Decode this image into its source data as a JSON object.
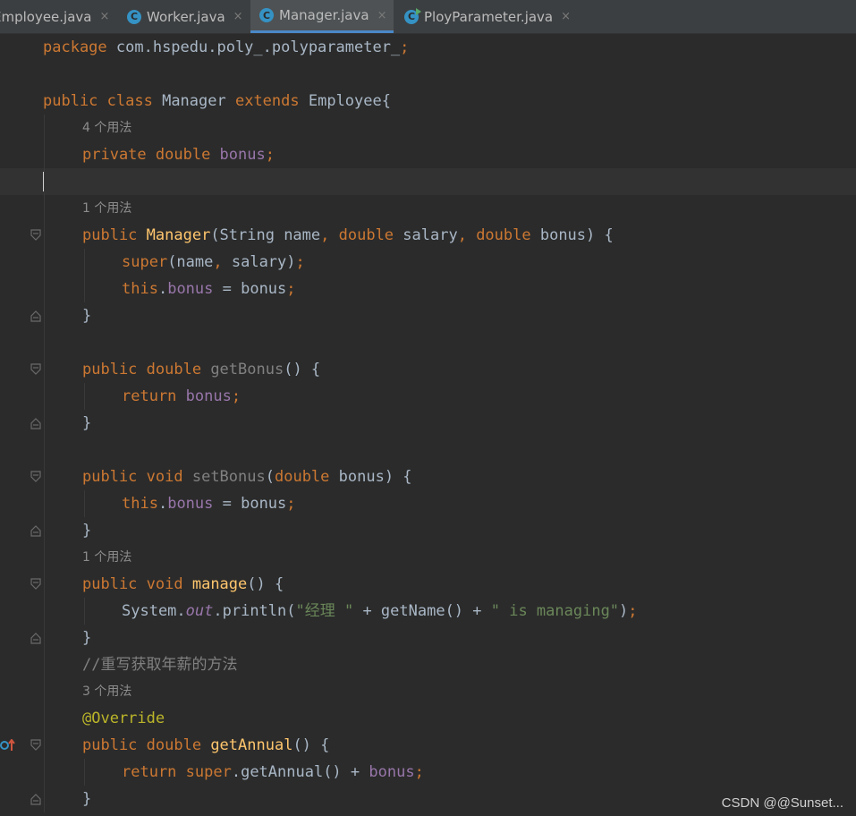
{
  "tabs": [
    {
      "label": "Employee.java",
      "icon": "class-icon",
      "active": false
    },
    {
      "label": "Worker.java",
      "icon": "class-icon",
      "active": false
    },
    {
      "label": "Manager.java",
      "icon": "class-icon",
      "active": true
    },
    {
      "label": "PloyParameter.java",
      "icon": "runnable-class-icon",
      "active": false
    }
  ],
  "tab_close_glyph": "×",
  "class_icon_letter": "C",
  "editor": {
    "lines": [
      {
        "indent": 0,
        "tokens": [
          {
            "t": "package ",
            "c": "kw"
          },
          {
            "t": "com.hspedu.poly_.polyparameter_",
            "c": "plain"
          },
          {
            "t": ";",
            "c": "kw"
          }
        ]
      },
      {
        "indent": 0,
        "tokens": []
      },
      {
        "indent": 0,
        "tokens": [
          {
            "t": "public ",
            "c": "kw"
          },
          {
            "t": "class ",
            "c": "kw"
          },
          {
            "t": "Manager ",
            "c": "plain"
          },
          {
            "t": "extends ",
            "c": "kw"
          },
          {
            "t": "Employee{",
            "c": "plain"
          }
        ]
      },
      {
        "indent": 1,
        "hint": "4 个用法"
      },
      {
        "indent": 1,
        "tokens": [
          {
            "t": "private ",
            "c": "kw"
          },
          {
            "t": "double ",
            "c": "kw"
          },
          {
            "t": "bonus",
            "c": "fld"
          },
          {
            "t": ";",
            "c": "kw"
          }
        ]
      },
      {
        "indent": 0,
        "tokens": [],
        "caret": true
      },
      {
        "indent": 1,
        "hint": "1 个用法"
      },
      {
        "indent": 1,
        "fold": "open",
        "tokens": [
          {
            "t": "public ",
            "c": "kw"
          },
          {
            "t": "Manager",
            "c": "fn"
          },
          {
            "t": "(String name",
            "c": "plain"
          },
          {
            "t": ", ",
            "c": "kw"
          },
          {
            "t": "double ",
            "c": "kw"
          },
          {
            "t": "salary",
            "c": "plain"
          },
          {
            "t": ", ",
            "c": "kw"
          },
          {
            "t": "double ",
            "c": "kw"
          },
          {
            "t": "bonus) {",
            "c": "plain"
          }
        ]
      },
      {
        "indent": 2,
        "tokens": [
          {
            "t": "super",
            "c": "kw"
          },
          {
            "t": "(name",
            "c": "plain"
          },
          {
            "t": ", ",
            "c": "kw"
          },
          {
            "t": "salary)",
            "c": "plain"
          },
          {
            "t": ";",
            "c": "kw"
          }
        ]
      },
      {
        "indent": 2,
        "tokens": [
          {
            "t": "this",
            "c": "kw"
          },
          {
            "t": ".",
            "c": "plain"
          },
          {
            "t": "bonus",
            "c": "fld"
          },
          {
            "t": " = bonus",
            "c": "plain"
          },
          {
            "t": ";",
            "c": "kw"
          }
        ]
      },
      {
        "indent": 1,
        "fold": "close",
        "tokens": [
          {
            "t": "}",
            "c": "plain"
          }
        ]
      },
      {
        "indent": 0,
        "tokens": []
      },
      {
        "indent": 1,
        "fold": "open",
        "tokens": [
          {
            "t": "public ",
            "c": "kw"
          },
          {
            "t": "double ",
            "c": "kw"
          },
          {
            "t": "getBonus",
            "c": "cmt"
          },
          {
            "t": "() {",
            "c": "plain"
          }
        ]
      },
      {
        "indent": 2,
        "tokens": [
          {
            "t": "return ",
            "c": "kw"
          },
          {
            "t": "bonus",
            "c": "fld"
          },
          {
            "t": ";",
            "c": "kw"
          }
        ]
      },
      {
        "indent": 1,
        "fold": "close",
        "tokens": [
          {
            "t": "}",
            "c": "plain"
          }
        ]
      },
      {
        "indent": 0,
        "tokens": []
      },
      {
        "indent": 1,
        "fold": "open",
        "tokens": [
          {
            "t": "public ",
            "c": "kw"
          },
          {
            "t": "void ",
            "c": "kw"
          },
          {
            "t": "setBonus",
            "c": "cmt"
          },
          {
            "t": "(",
            "c": "plain"
          },
          {
            "t": "double ",
            "c": "kw"
          },
          {
            "t": "bonus) {",
            "c": "plain"
          }
        ]
      },
      {
        "indent": 2,
        "tokens": [
          {
            "t": "this",
            "c": "kw"
          },
          {
            "t": ".",
            "c": "plain"
          },
          {
            "t": "bonus",
            "c": "fld"
          },
          {
            "t": " = bonus",
            "c": "plain"
          },
          {
            "t": ";",
            "c": "kw"
          }
        ]
      },
      {
        "indent": 1,
        "fold": "close",
        "tokens": [
          {
            "t": "}",
            "c": "plain"
          }
        ]
      },
      {
        "indent": 1,
        "hint": "1 个用法"
      },
      {
        "indent": 1,
        "fold": "open",
        "tokens": [
          {
            "t": "public ",
            "c": "kw"
          },
          {
            "t": "void ",
            "c": "kw"
          },
          {
            "t": "manage",
            "c": "fn"
          },
          {
            "t": "() {",
            "c": "plain"
          }
        ]
      },
      {
        "indent": 2,
        "tokens": [
          {
            "t": "System.",
            "c": "plain"
          },
          {
            "t": "out",
            "c": "stat"
          },
          {
            "t": ".println(",
            "c": "plain"
          },
          {
            "t": "\"经理 \"",
            "c": "str"
          },
          {
            "t": " + getName() + ",
            "c": "plain"
          },
          {
            "t": "\" is managing\"",
            "c": "str"
          },
          {
            "t": ")",
            "c": "plain"
          },
          {
            "t": ";",
            "c": "kw"
          }
        ]
      },
      {
        "indent": 1,
        "fold": "close",
        "tokens": [
          {
            "t": "}",
            "c": "plain"
          }
        ]
      },
      {
        "indent": 1,
        "tokens": [
          {
            "t": "//重写获取年薪的方法",
            "c": "cmt"
          }
        ]
      },
      {
        "indent": 1,
        "hint": "3 个用法"
      },
      {
        "indent": 1,
        "tokens": [
          {
            "t": "@Override",
            "c": "ann"
          }
        ]
      },
      {
        "indent": 1,
        "fold": "open",
        "override": true,
        "tokens": [
          {
            "t": "public ",
            "c": "kw"
          },
          {
            "t": "double ",
            "c": "kw"
          },
          {
            "t": "getAnnual",
            "c": "fn"
          },
          {
            "t": "() {",
            "c": "plain"
          }
        ]
      },
      {
        "indent": 2,
        "tokens": [
          {
            "t": "return ",
            "c": "kw"
          },
          {
            "t": "super",
            "c": "kw"
          },
          {
            "t": ".getAnnual() + ",
            "c": "plain"
          },
          {
            "t": "bonus",
            "c": "fld"
          },
          {
            "t": ";",
            "c": "kw"
          }
        ]
      },
      {
        "indent": 1,
        "fold": "close",
        "tokens": [
          {
            "t": "}",
            "c": "plain"
          }
        ]
      }
    ]
  },
  "watermark": "CSDN @@Sunset...",
  "colors": {
    "keyword": "#cc7832",
    "field": "#9876aa",
    "method": "#ffc66d",
    "string": "#6a8759",
    "annotation": "#bbb529",
    "comment": "#808080",
    "text": "#a9b7c6",
    "background": "#2b2b2b",
    "tab_underline": "#4a88c7"
  }
}
